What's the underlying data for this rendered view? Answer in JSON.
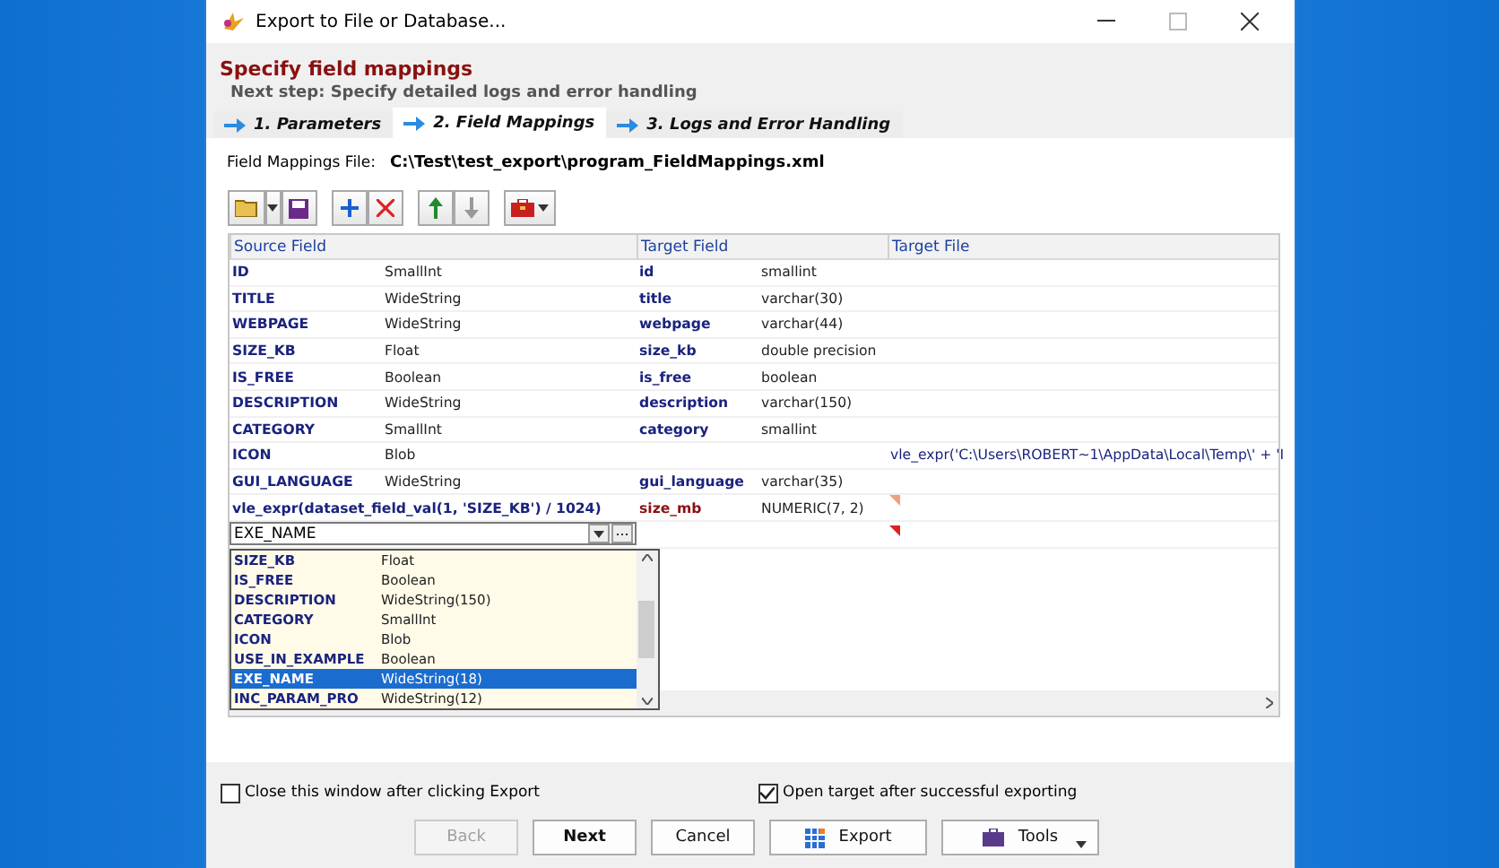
{
  "window": {
    "title": "Export to File or Database..."
  },
  "header": {
    "title": "Specify field mappings",
    "subtitle": "Next step: Specify detailed logs and error handling"
  },
  "tabs": [
    {
      "label": "1. Parameters",
      "selected": false
    },
    {
      "label": "2. Field Mappings",
      "selected": true
    },
    {
      "label": "3. Logs and Error Handling",
      "selected": false
    }
  ],
  "mapping_file": {
    "label": "Field Mappings File:",
    "value": "C:\\Test\\test_export\\program_FieldMappings.xml"
  },
  "grid": {
    "columns": [
      "Source Field",
      "Target Field",
      "Target File"
    ],
    "rows": [
      {
        "kind": "field",
        "source": "ID",
        "source_type": "SmallInt",
        "target": "id",
        "target_type": "smallint",
        "target_file": ""
      },
      {
        "kind": "field",
        "source": "TITLE",
        "source_type": "WideString",
        "target": "title",
        "target_type": "varchar(30)",
        "target_file": ""
      },
      {
        "kind": "field",
        "source": "WEBPAGE",
        "source_type": "WideString",
        "target": "webpage",
        "target_type": "varchar(44)",
        "target_file": ""
      },
      {
        "kind": "field",
        "source": "SIZE_KB",
        "source_type": "Float",
        "target": "size_kb",
        "target_type": "double precision",
        "target_file": ""
      },
      {
        "kind": "field",
        "source": "IS_FREE",
        "source_type": "Boolean",
        "target": "is_free",
        "target_type": "boolean",
        "target_file": ""
      },
      {
        "kind": "field",
        "source": "DESCRIPTION",
        "source_type": "WideString",
        "target": "description",
        "target_type": "varchar(150)",
        "target_file": ""
      },
      {
        "kind": "field",
        "source": "CATEGORY",
        "source_type": "SmallInt",
        "target": "category",
        "target_type": "smallint",
        "target_file": ""
      },
      {
        "kind": "field",
        "source": "ICON",
        "source_type": "Blob",
        "target": "",
        "target_type": "",
        "target_file": "vle_expr('C:\\Users\\ROBERT~1\\AppData\\Local\\Temp\\' + 'I"
      },
      {
        "kind": "field",
        "source": "GUI_LANGUAGE",
        "source_type": "WideString",
        "target": "gui_language",
        "target_type": "varchar(35)",
        "target_file": ""
      },
      {
        "kind": "expression",
        "source": "vle_expr(dataset_field_val(1, 'SIZE_KB') / 1024)",
        "source_type": "",
        "target": "size_mb",
        "target_type": "NUMERIC(7, 2)",
        "target_file": ""
      },
      {
        "kind": "editing",
        "source": "EXE_NAME",
        "source_type": "",
        "target": "",
        "target_type": "",
        "target_file": ""
      }
    ],
    "dropdown": [
      {
        "name": "SIZE_KB",
        "type": "Float",
        "selected": false
      },
      {
        "name": "IS_FREE",
        "type": "Boolean",
        "selected": false
      },
      {
        "name": "DESCRIPTION",
        "type": "WideString(150)",
        "selected": false
      },
      {
        "name": "CATEGORY",
        "type": "SmallInt",
        "selected": false
      },
      {
        "name": "ICON",
        "type": "Blob",
        "selected": false
      },
      {
        "name": "USE_IN_EXAMPLE",
        "type": "Boolean",
        "selected": false
      },
      {
        "name": "EXE_NAME",
        "type": "WideString(18)",
        "selected": true
      },
      {
        "name": "INC_PARAM_PRO",
        "type": "WideString(12)",
        "selected": false
      }
    ]
  },
  "options": [
    {
      "label": "Close this window after clicking Export",
      "checked": false
    },
    {
      "label": "Open target after successful exporting",
      "checked": true
    }
  ],
  "buttons": [
    {
      "kind": "plain",
      "label": "Back",
      "disabled": true
    },
    {
      "kind": "plain",
      "label": "Next",
      "disabled": false
    },
    {
      "kind": "plain",
      "label": "Cancel",
      "disabled": false
    },
    {
      "kind": "export",
      "label": "Export",
      "disabled": false
    },
    {
      "kind": "tools",
      "label": "Tools",
      "disabled": false
    }
  ]
}
